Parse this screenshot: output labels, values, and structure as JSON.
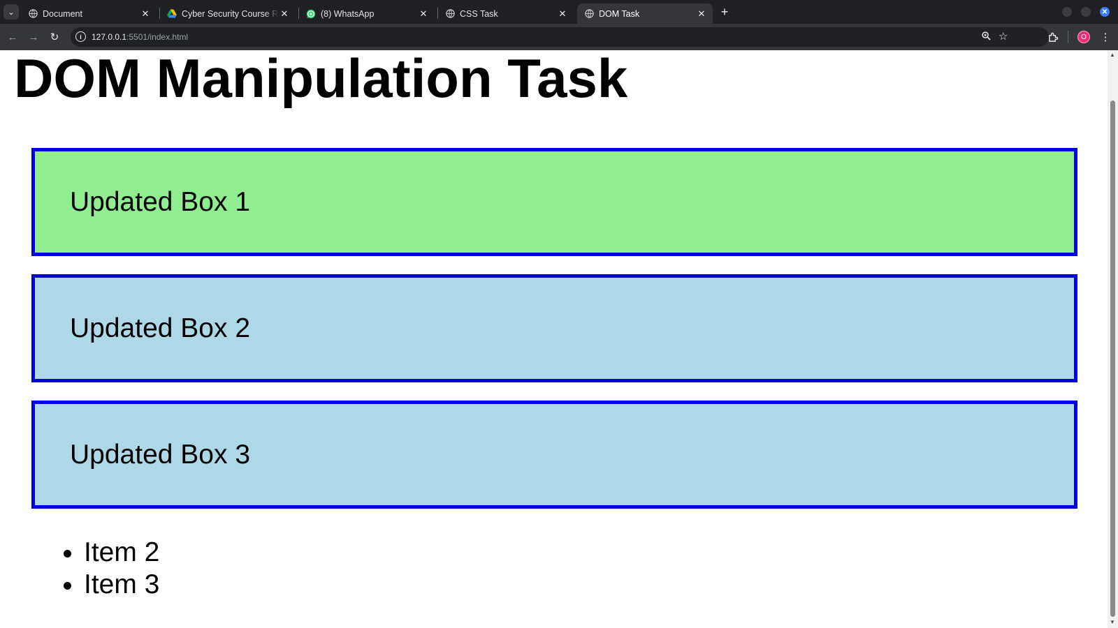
{
  "tabs": [
    {
      "title": "Document",
      "favicon": "globe-icon",
      "active": false
    },
    {
      "title": "Cyber Security Course Ro",
      "favicon": "google-drive-icon",
      "active": false
    },
    {
      "title": "(8) WhatsApp",
      "favicon": "whatsapp-icon",
      "active": false
    },
    {
      "title": "CSS Task",
      "favicon": "globe-icon",
      "active": false
    },
    {
      "title": "DOM Task",
      "favicon": "globe-icon",
      "active": true
    }
  ],
  "address_bar": {
    "host": "127.0.0.1",
    "path": ":5501/index.html"
  },
  "profile_initial": "O",
  "page": {
    "heading": "DOM Manipulation Task",
    "boxes": [
      {
        "text": "Updated Box 1",
        "background": "#90ee90"
      },
      {
        "text": "Updated Box 2",
        "background": "#add8e6"
      },
      {
        "text": "Updated Box 3",
        "background": "#add8e6"
      }
    ],
    "box_border_color": "#0000dd",
    "list_items": [
      "Item 2",
      "Item 3"
    ]
  },
  "colors": {
    "tabstrip_bg": "#1f2024",
    "toolbar_bg": "#35363a",
    "omnibox_bg": "#202124"
  }
}
